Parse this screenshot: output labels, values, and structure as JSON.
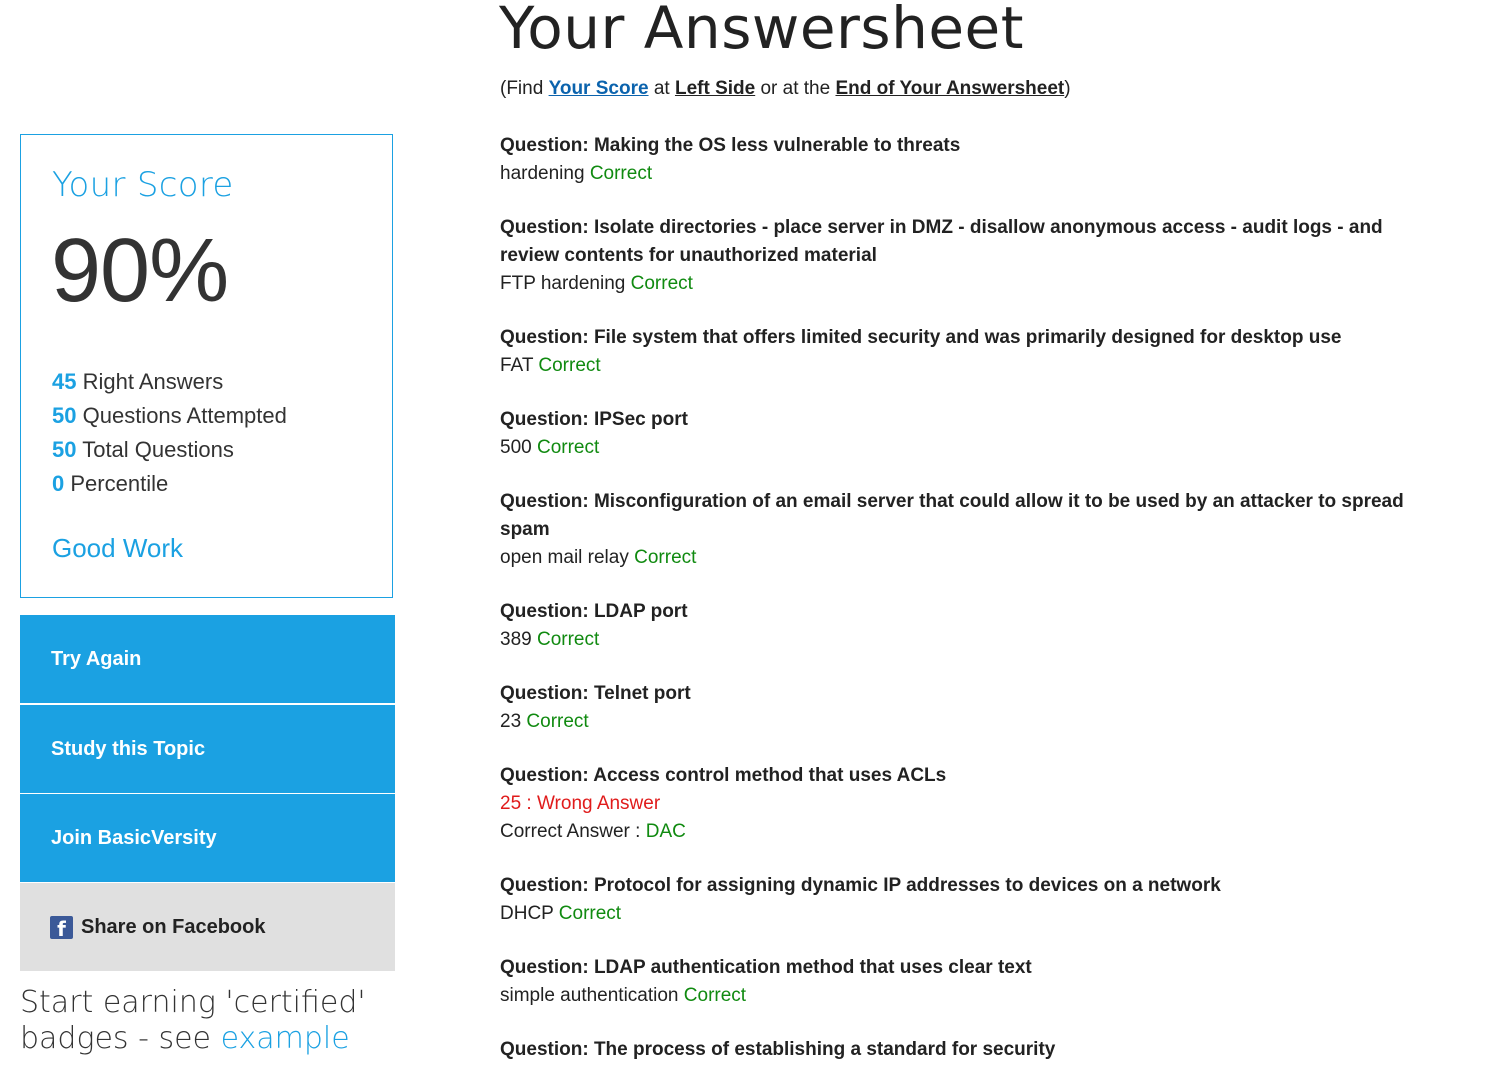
{
  "sidebar": {
    "score_title": "Your Score",
    "score_value": "90%",
    "stats": [
      {
        "num": "45",
        "label": "Right Answers"
      },
      {
        "num": "50",
        "label": "Questions Attempted"
      },
      {
        "num": "50",
        "label": "Total Questions"
      },
      {
        "num": "0",
        "label": "Percentile"
      }
    ],
    "message": "Good Work",
    "buttons": {
      "try_again": "Try Again",
      "study": "Study this Topic",
      "join": "Join BasicVersity",
      "share": "Share on Facebook"
    },
    "earn_text": "Start earning 'certified' badges - see",
    "earn_link": "example"
  },
  "main": {
    "title": "Your Answersheet",
    "subtitle": {
      "open": "(Find",
      "your_score": "Your Score",
      "at": "at",
      "left_side": "Left Side",
      "or_at_the": "or at the",
      "end": "End of Your Answersheet",
      "close": ")"
    },
    "items": [
      {
        "q": "Question: Making the OS less vulnerable to threats",
        "a": "hardening",
        "result": "Correct"
      },
      {
        "q": "Question: Isolate directories - place server in DMZ - disallow anonymous access - audit logs - and review contents for unauthorized material",
        "a": "FTP hardening",
        "result": "Correct"
      },
      {
        "q": "Question: File system that offers limited security and was primarily designed for desktop use",
        "a": "FAT",
        "result": "Correct"
      },
      {
        "q": "Question: IPSec port",
        "a": "500",
        "result": "Correct"
      },
      {
        "q": "Question: Misconfiguration of an email server that could allow it to be used by an attacker to spread spam",
        "a": "open mail relay",
        "result": "Correct"
      },
      {
        "q": "Question: LDAP port",
        "a": "389",
        "result": "Correct"
      },
      {
        "q": "Question: Telnet port",
        "a": "23",
        "result": "Correct"
      },
      {
        "q": "Question: Access control method that uses ACLs",
        "wrong": "25 : Wrong Answer",
        "correct_label": "Correct Answer :",
        "correct_answer": "DAC"
      },
      {
        "q": "Question: Protocol for assigning dynamic IP addresses to devices on a network",
        "a": "DHCP",
        "result": "Correct"
      },
      {
        "q": "Question: LDAP authentication method that uses clear text",
        "a": "simple authentication",
        "result": "Correct"
      },
      {
        "q": "Question: The process of establishing a standard for security"
      }
    ]
  },
  "colors": {
    "accent": "#1ba1e2",
    "correct": "#108a10",
    "wrong": "#e01b1b",
    "link": "#0b63ad",
    "facebook": "#3b5998"
  }
}
